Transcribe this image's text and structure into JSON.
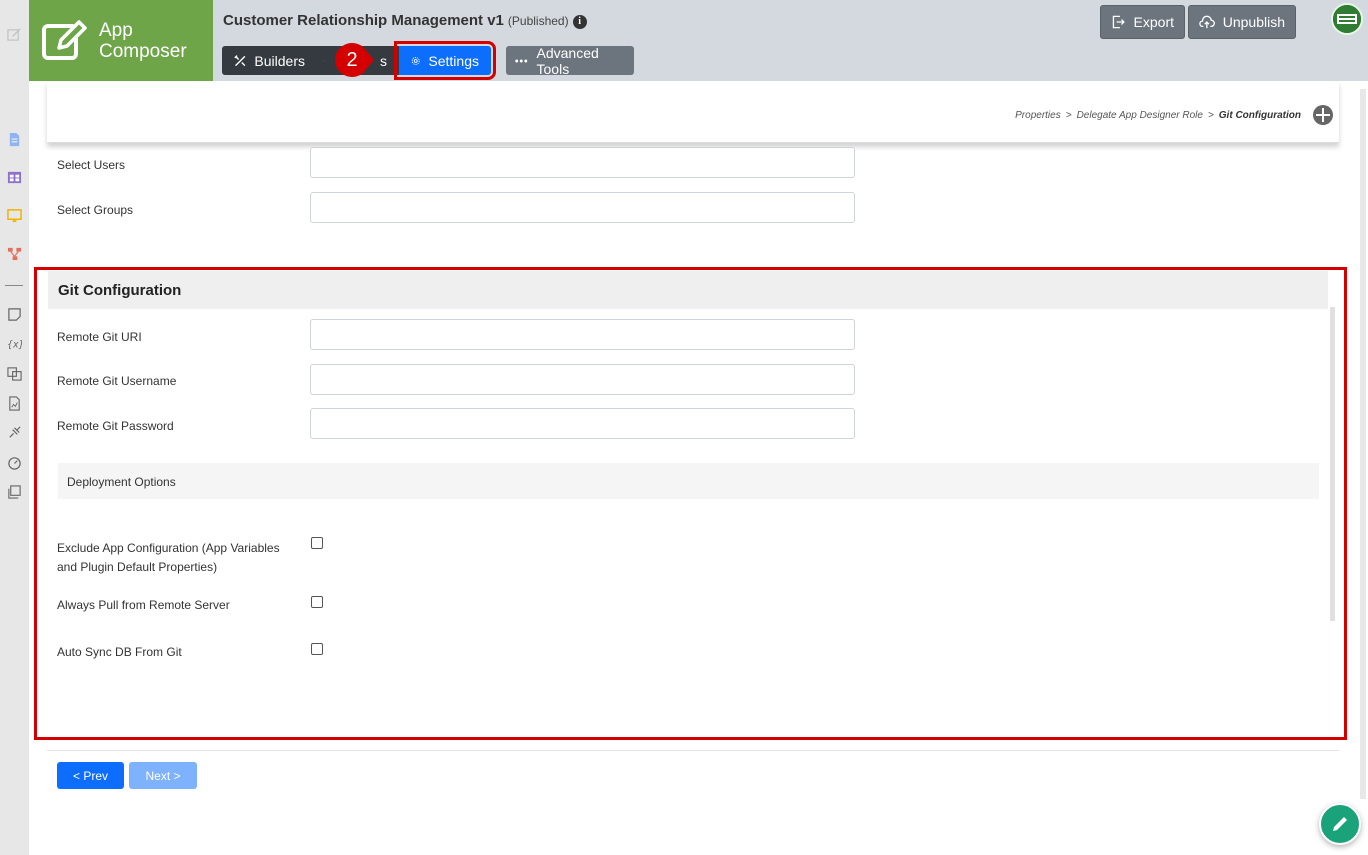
{
  "brand": {
    "line1": "App",
    "line2": "Composer"
  },
  "app": {
    "title": "Customer Relationship Management v1",
    "status": "(Published)"
  },
  "tabs": {
    "builders": "Builders",
    "hidden": "s",
    "settings": "Settings",
    "advanced": "Advanced Tools"
  },
  "step_badge": "2",
  "header_buttons": {
    "export": "Export",
    "unpublish": "Unpublish"
  },
  "breadcrumb": {
    "items": [
      "Properties",
      "Delegate App Designer Role",
      "Git Configuration"
    ],
    "separator": ">"
  },
  "delegate": {
    "select_users": {
      "label": "Select Users",
      "value": ""
    },
    "select_groups": {
      "label": "Select Groups",
      "value": ""
    }
  },
  "git": {
    "title": "Git Configuration",
    "remote_uri": {
      "label": "Remote Git URI",
      "value": ""
    },
    "remote_username": {
      "label": "Remote Git Username",
      "value": ""
    },
    "remote_password": {
      "label": "Remote Git Password",
      "value": ""
    },
    "deployment_title": "Deployment Options",
    "exclude_config": {
      "label_line1": "Exclude App Configuration (App Variables",
      "label_line2": "and Plugin Default Properties)",
      "checked": false
    },
    "always_pull": {
      "label": "Always Pull from Remote Server",
      "checked": false
    },
    "auto_sync": {
      "label": "Auto Sync DB From Git",
      "checked": false
    }
  },
  "nav": {
    "prev": "< Prev",
    "next": "Next >"
  },
  "colors": {
    "brand": "#6ea549",
    "primary": "#0d6efd",
    "highlight": "#d40000",
    "fab": "#1aa37a"
  }
}
